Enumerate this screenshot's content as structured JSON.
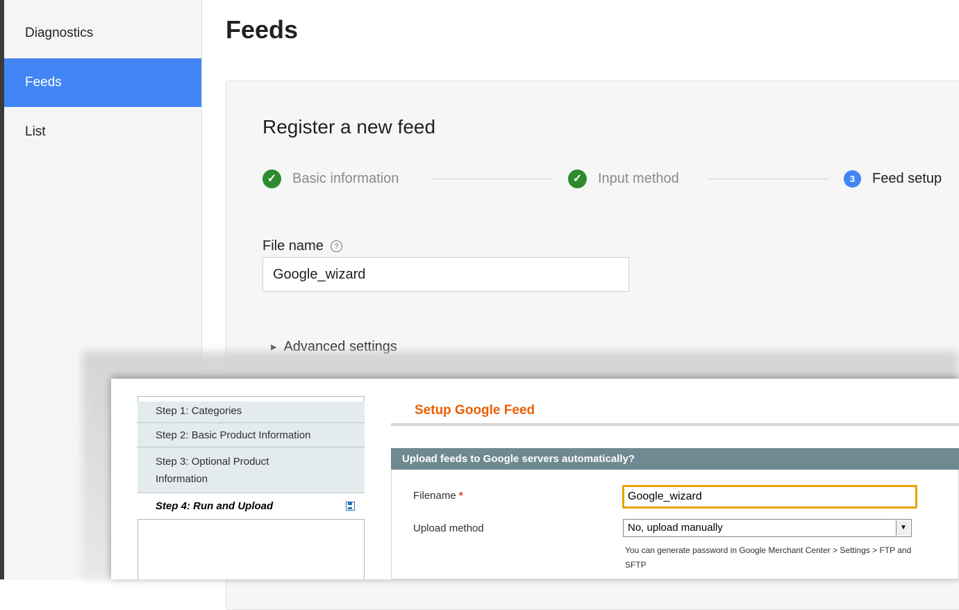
{
  "sidebar": {
    "items": [
      {
        "label": "Diagnostics",
        "active": false
      },
      {
        "label": "Feeds",
        "active": true
      },
      {
        "label": "List",
        "active": false
      }
    ]
  },
  "page": {
    "title": "Feeds"
  },
  "register": {
    "title": "Register a new feed",
    "steps": [
      {
        "label": "Basic information",
        "status": "done"
      },
      {
        "label": "Input method",
        "status": "done"
      },
      {
        "label": "Feed setup",
        "status": "current",
        "number": "3"
      }
    ],
    "file_name_label": "File name",
    "file_name_value": "Google_wizard",
    "advanced_label": "Advanced settings"
  },
  "legacy": {
    "wizard_steps": [
      {
        "label": "Step 1: Categories"
      },
      {
        "label": "Step 2: Basic Product Information"
      },
      {
        "label": "Step 3: Optional Product Information"
      },
      {
        "label": "Step 4: Run and Upload"
      }
    ],
    "setup_title": "Setup Google Feed",
    "section_title": "Upload feeds to Google servers automatically?",
    "filename_label": "Filename",
    "required_mark": "*",
    "filename_value": "Google_wizard",
    "upload_method_label": "Upload method",
    "upload_method_value": "No, upload manually",
    "hint": "You can generate password in Google Merchant Center > Settings > FTP and SFTP"
  },
  "colors": {
    "accent": "#4285f4",
    "check_green": "#2e8b2e",
    "legacy_orange": "#eb5e00",
    "legacy_section": "#6f8992",
    "focus_border": "#e6a400"
  }
}
